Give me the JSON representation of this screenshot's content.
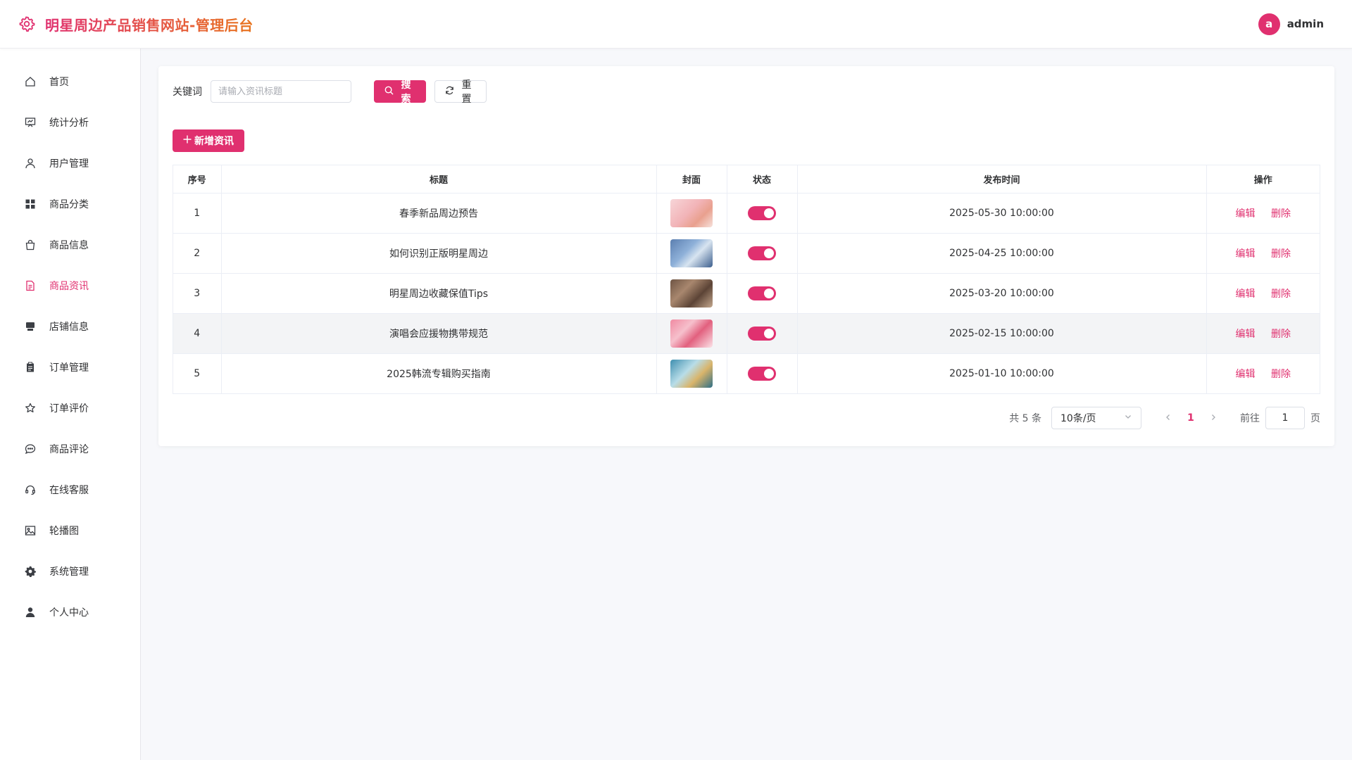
{
  "header": {
    "title": "明星周边产品销售网站-管理后台",
    "logo_icon": "gear-icon",
    "user": {
      "avatar_letter": "a",
      "name": "admin"
    }
  },
  "colors": {
    "accent": "#e0306f",
    "title_gradient_end": "#e8741e"
  },
  "sidebar": {
    "items": [
      {
        "label": "首页",
        "icon": "home-icon",
        "active": false
      },
      {
        "label": "统计分析",
        "icon": "presentation-chart-icon",
        "active": false
      },
      {
        "label": "用户管理",
        "icon": "user-icon",
        "active": false
      },
      {
        "label": "商品分类",
        "icon": "grid-icon",
        "active": false
      },
      {
        "label": "商品信息",
        "icon": "shopping-bag-icon",
        "active": false
      },
      {
        "label": "商品资讯",
        "icon": "document-icon",
        "active": true
      },
      {
        "label": "店铺信息",
        "icon": "shop-icon",
        "active": false
      },
      {
        "label": "订单管理",
        "icon": "clipboard-icon",
        "active": false
      },
      {
        "label": "订单评价",
        "icon": "star-icon",
        "active": false
      },
      {
        "label": "商品评论",
        "icon": "chat-bubble-icon",
        "active": false
      },
      {
        "label": "在线客服",
        "icon": "headset-icon",
        "active": false
      },
      {
        "label": "轮播图",
        "icon": "picture-icon",
        "active": false
      },
      {
        "label": "系统管理",
        "icon": "settings-icon",
        "active": false
      },
      {
        "label": "个人中心",
        "icon": "person-icon",
        "active": false
      }
    ]
  },
  "search": {
    "label": "关键词",
    "placeholder": "请输入资讯标题",
    "value": "",
    "search_button": "搜索",
    "reset_button": "重置"
  },
  "toolbar": {
    "add_button": "新增资讯"
  },
  "table": {
    "columns": [
      "序号",
      "标题",
      "封面",
      "状态",
      "发布时间",
      "操作"
    ],
    "rows": [
      {
        "index": "1",
        "title": "春季新品周边预告",
        "cover": "thumbnail-pink-flowers",
        "status_on": true,
        "time": "2025-05-30 10:00:00",
        "edit": "编辑",
        "delete": "删除"
      },
      {
        "index": "2",
        "title": "如何识别正版明星周边",
        "cover": "thumbnail-blue-street",
        "status_on": true,
        "time": "2025-04-25 10:00:00",
        "edit": "编辑",
        "delete": "删除"
      },
      {
        "index": "3",
        "title": "明星周边收藏保值Tips",
        "cover": "thumbnail-brown-collection",
        "status_on": true,
        "time": "2025-03-20 10:00:00",
        "edit": "编辑",
        "delete": "删除"
      },
      {
        "index": "4",
        "title": "演唱会应援物携带规范",
        "cover": "thumbnail-pink-concert",
        "status_on": true,
        "time": "2025-02-15 10:00:00",
        "edit": "编辑",
        "delete": "删除"
      },
      {
        "index": "5",
        "title": "2025韩流专辑购买指南",
        "cover": "thumbnail-teal-albums",
        "status_on": true,
        "time": "2025-01-10 10:00:00",
        "edit": "编辑",
        "delete": "删除"
      }
    ]
  },
  "pagination": {
    "total": "共 5 条",
    "page_size": "10条/页",
    "current_page": "1",
    "goto_label": "前往",
    "goto_value": "1",
    "goto_suffix": "页"
  }
}
